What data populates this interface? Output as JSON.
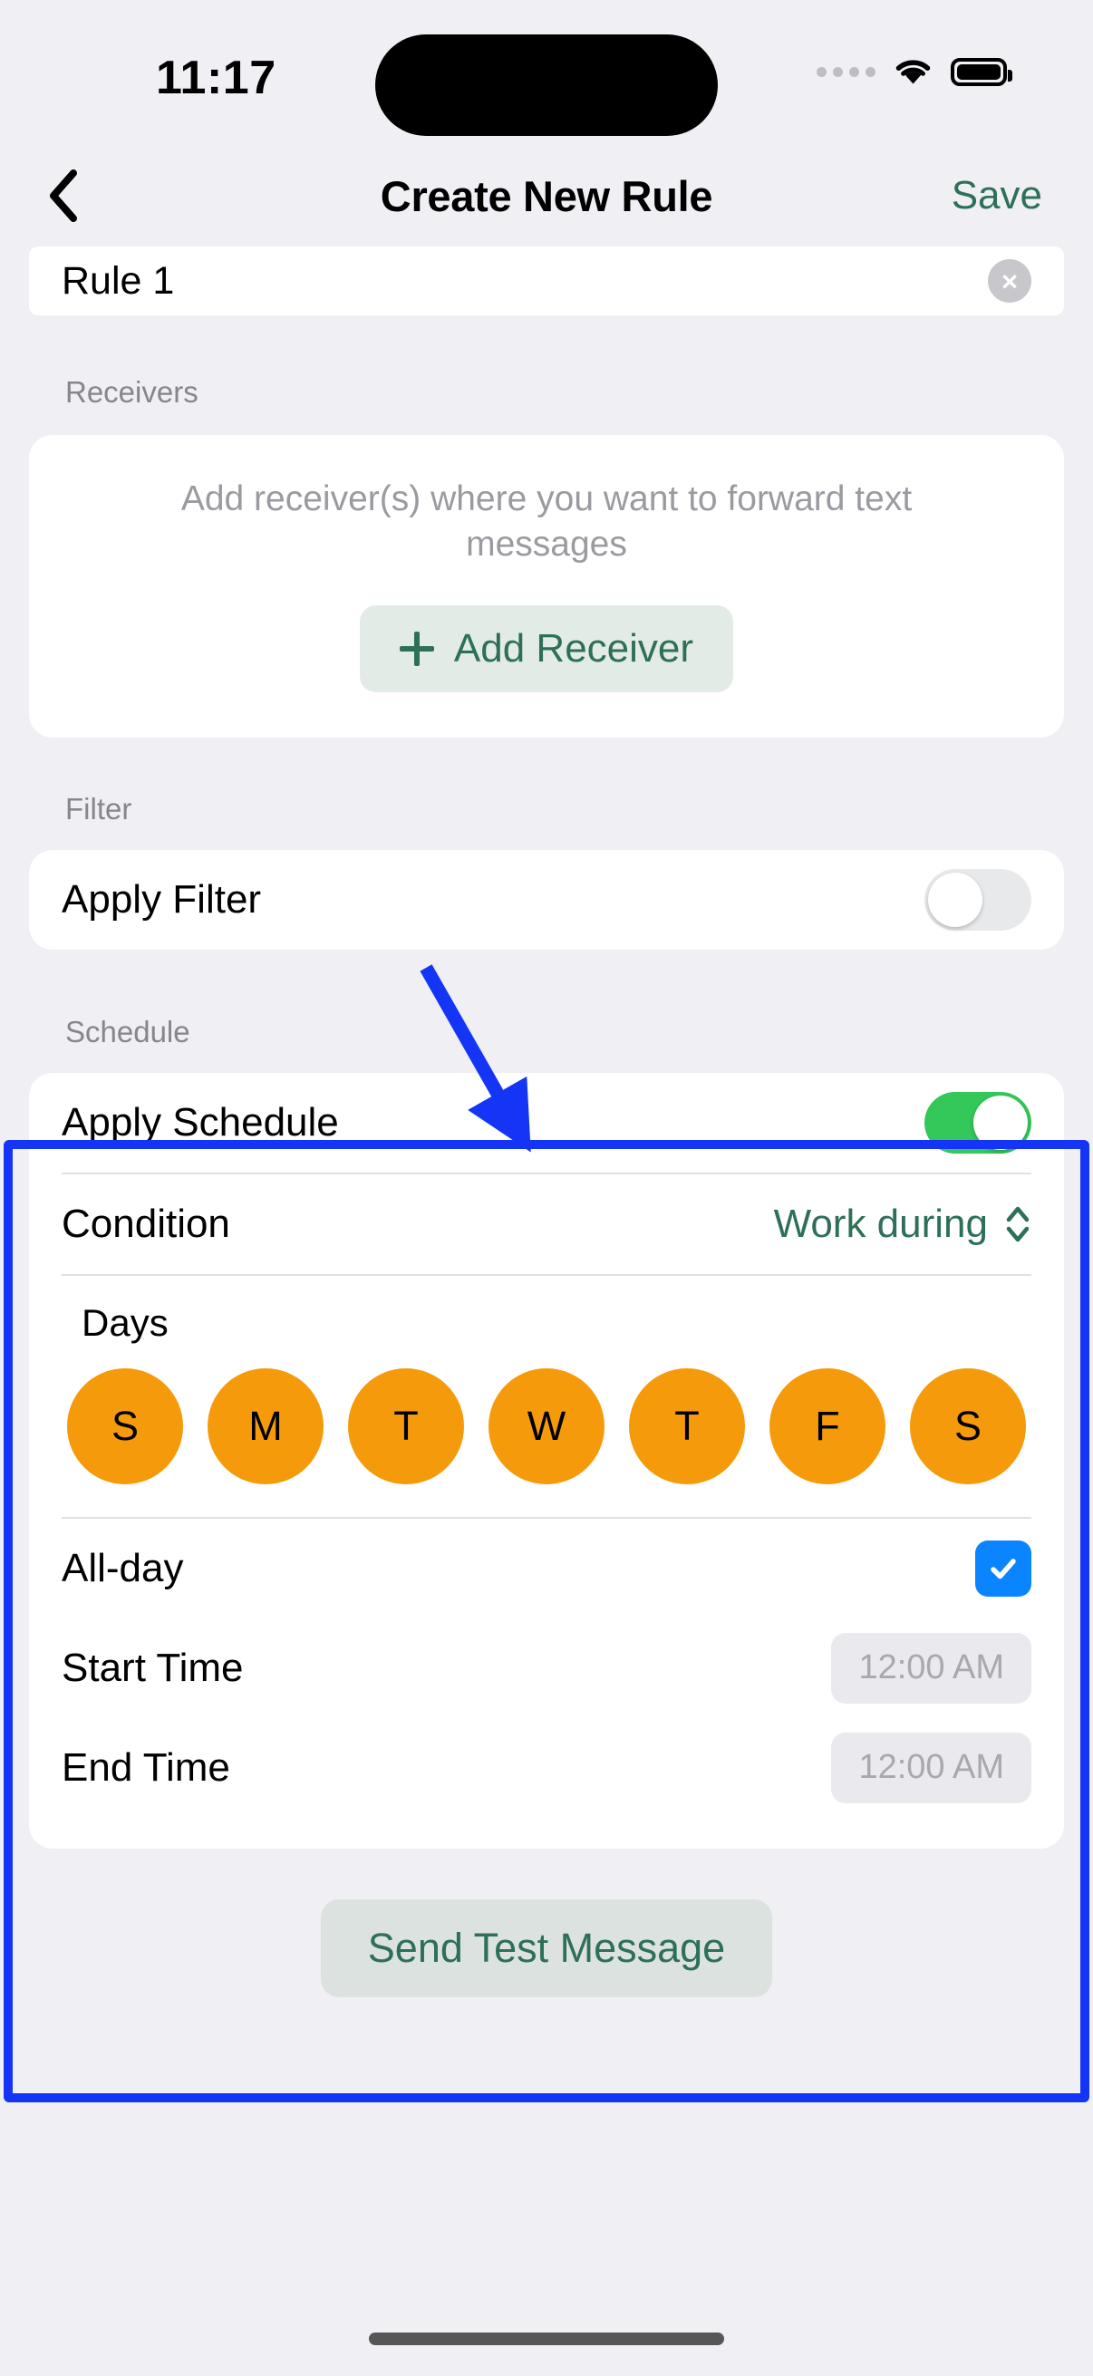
{
  "status_bar": {
    "time": "11:17",
    "cellular_icon": "cellular-dots-icon",
    "wifi_icon": "wifi-icon",
    "battery_icon": "battery-full-icon"
  },
  "nav": {
    "back_icon": "chevron-left-icon",
    "title": "Create New Rule",
    "save_label": "Save"
  },
  "rule_name": {
    "value": "Rule 1",
    "clear_icon": "×"
  },
  "receivers": {
    "section_label": "Receivers",
    "description": "Add receiver(s) where you want to forward text messages",
    "add_button_label": "Add Receiver",
    "add_button_icon": "plus-icon"
  },
  "filter": {
    "section_label": "Filter",
    "apply_label": "Apply Filter",
    "apply_state": "off"
  },
  "schedule": {
    "section_label": "Schedule",
    "apply_label": "Apply Schedule",
    "apply_state": "on",
    "condition_label": "Condition",
    "condition_value": "Work during",
    "condition_icon": "chevron-up-down-icon",
    "days_label": "Days",
    "days": [
      {
        "letter": "S",
        "selected": true
      },
      {
        "letter": "M",
        "selected": true
      },
      {
        "letter": "T",
        "selected": true
      },
      {
        "letter": "W",
        "selected": true
      },
      {
        "letter": "T",
        "selected": true
      },
      {
        "letter": "F",
        "selected": true
      },
      {
        "letter": "S",
        "selected": true
      }
    ],
    "all_day_label": "All-day",
    "all_day_checked": true,
    "all_day_icon": "checkmark-icon",
    "start_time_label": "Start Time",
    "start_time_value": "12:00 AM",
    "end_time_label": "End Time",
    "end_time_value": "12:00 AM"
  },
  "footer": {
    "test_button_label": "Send Test Message"
  },
  "annotation": {
    "arrow_color": "#1435F5",
    "highlight_color": "#1435F5"
  },
  "colors": {
    "accent_green": "#2E7057",
    "toggle_on": "#34C759",
    "day_selected": "#F59B0B",
    "checkbox_blue": "#0A84FF",
    "page_bg": "#EFEFF4"
  }
}
